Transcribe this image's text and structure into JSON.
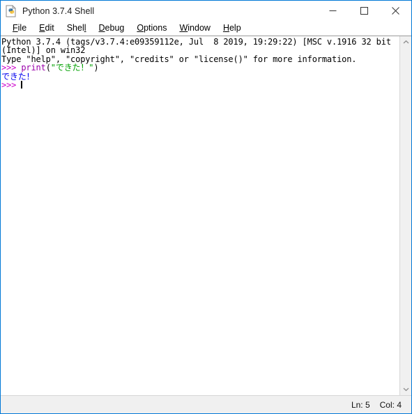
{
  "window": {
    "title": "Python 3.7.4 Shell",
    "icon": "python-file-icon",
    "border_color": "#0078d7",
    "controls": [
      {
        "name": "minimize-button",
        "glyph": "minimize-icon",
        "label": "Minimize"
      },
      {
        "name": "maximize-button",
        "glyph": "maximize-icon",
        "label": "Maximize"
      },
      {
        "name": "close-button",
        "glyph": "close-icon",
        "label": "Close"
      }
    ]
  },
  "menubar": {
    "items": [
      {
        "label": "File",
        "mnemonic_index": 0
      },
      {
        "label": "Edit",
        "mnemonic_index": 0
      },
      {
        "label": "Shell",
        "mnemonic_index": 4
      },
      {
        "label": "Debug",
        "mnemonic_index": 0
      },
      {
        "label": "Options",
        "mnemonic_index": 0
      },
      {
        "label": "Window",
        "mnemonic_index": 0
      },
      {
        "label": "Help",
        "mnemonic_index": 0
      }
    ]
  },
  "console": {
    "colors": {
      "prompt": "#cc00cc",
      "keyword": "#9900aa",
      "string": "#00a000",
      "output": "#0000ee",
      "plain": "#000000",
      "background": "#ffffff"
    },
    "lines": [
      {
        "segments": [
          {
            "text": "Python 3.7.4 (tags/v3.7.4:e09359112e, Jul  8 2019, 19:29:22) [MSC v.1916 32 bit",
            "style": "plain"
          }
        ]
      },
      {
        "segments": [
          {
            "text": "(Intel)] on win32",
            "style": "plain"
          }
        ]
      },
      {
        "segments": [
          {
            "text": "Type \"help\", \"copyright\", \"credits\" or \"license()\" for more information.",
            "style": "plain"
          }
        ]
      },
      {
        "segments": [
          {
            "text": ">>> ",
            "style": "prompt"
          },
          {
            "text": "print",
            "style": "keyword"
          },
          {
            "text": "(",
            "style": "plain"
          },
          {
            "text": "\"できた！\"",
            "style": "string"
          },
          {
            "text": ")",
            "style": "plain"
          }
        ]
      },
      {
        "segments": [
          {
            "text": "できた！",
            "style": "output"
          }
        ]
      },
      {
        "segments": [
          {
            "text": ">>> ",
            "style": "prompt"
          }
        ],
        "caret": true
      }
    ]
  },
  "scrollbar": {
    "up_arrow": "chevron-up-icon",
    "down_arrow": "chevron-down-icon"
  },
  "statusbar": {
    "line_label": "Ln: 5",
    "col_label": "Col: 4"
  }
}
